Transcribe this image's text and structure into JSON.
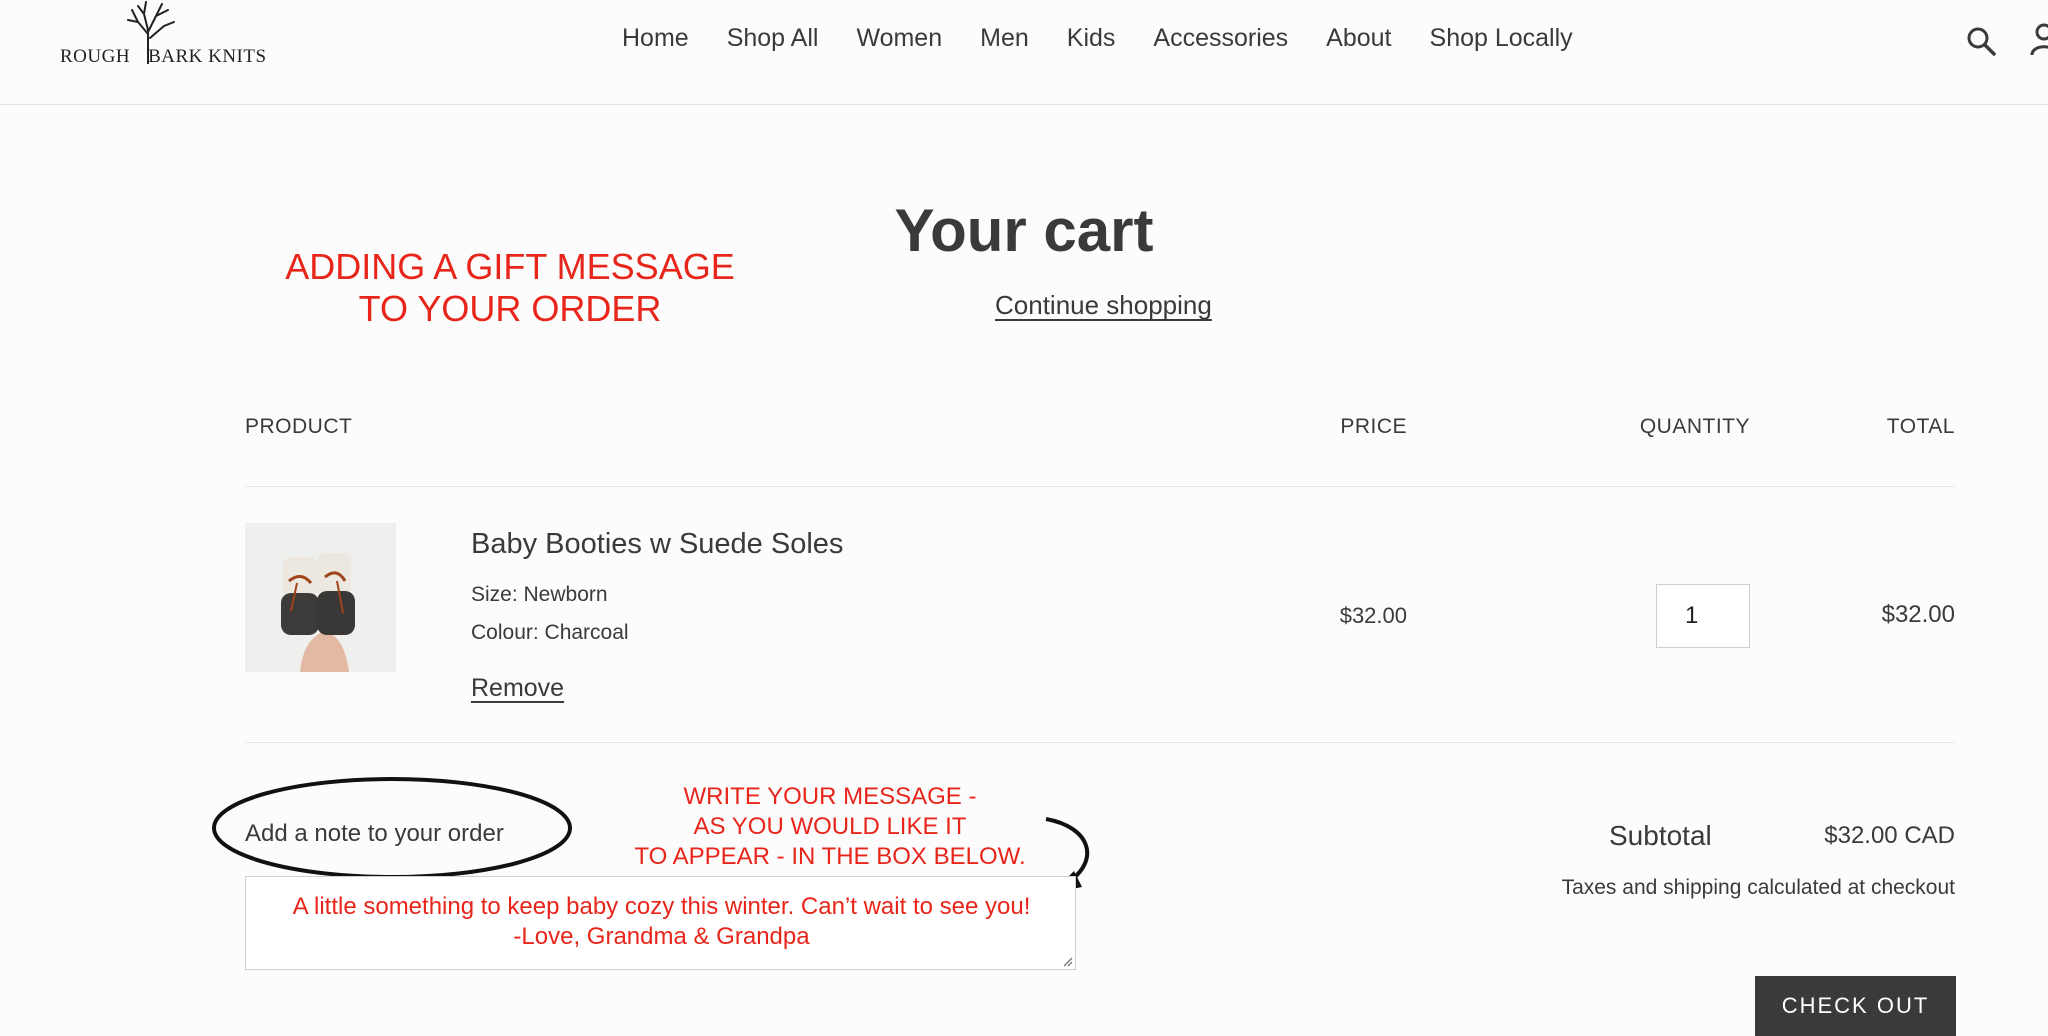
{
  "brand": {
    "logo_left": "ROUGH",
    "logo_right": "BARK KNITS"
  },
  "nav": {
    "items": [
      "Home",
      "Shop All",
      "Women",
      "Men",
      "Kids",
      "Accessories",
      "About",
      "Shop Locally"
    ]
  },
  "icons": {
    "search": "search-icon",
    "account": "account-icon"
  },
  "cart": {
    "title": "Your cart",
    "continue_label": "Continue shopping",
    "headers": {
      "product": "PRODUCT",
      "price": "PRICE",
      "quantity": "QUANTITY",
      "total": "TOTAL"
    },
    "items": [
      {
        "name": "Baby Booties w Suede Soles",
        "size": "Size: Newborn",
        "colour": "Colour: Charcoal",
        "remove_label": "Remove",
        "price": "$32.00",
        "quantity": "1",
        "total": "$32.00"
      }
    ],
    "note_label": "Add a note to your order",
    "note_text_line1": "A little something to keep baby cozy this winter. Can’t wait to see you!",
    "note_text_line2": "-Love, Grandma & Grandpa",
    "subtotal_label": "Subtotal",
    "subtotal_value": "$32.00 CAD",
    "taxes_note": "Taxes and shipping calculated at checkout",
    "checkout_label": "CHECK OUT"
  },
  "annotations": {
    "top_line1": "ADDING A GIFT MESSAGE",
    "top_line2": "TO YOUR ORDER",
    "mid_line1": "WRITE YOUR MESSAGE -",
    "mid_line2": "AS YOU WOULD LIKE IT",
    "mid_line3": "TO APPEAR - IN THE BOX BELOW."
  },
  "colors": {
    "annotation_red": "#e8251a",
    "text": "#3a3a3a",
    "checkout_bg": "#3a3a3a"
  }
}
